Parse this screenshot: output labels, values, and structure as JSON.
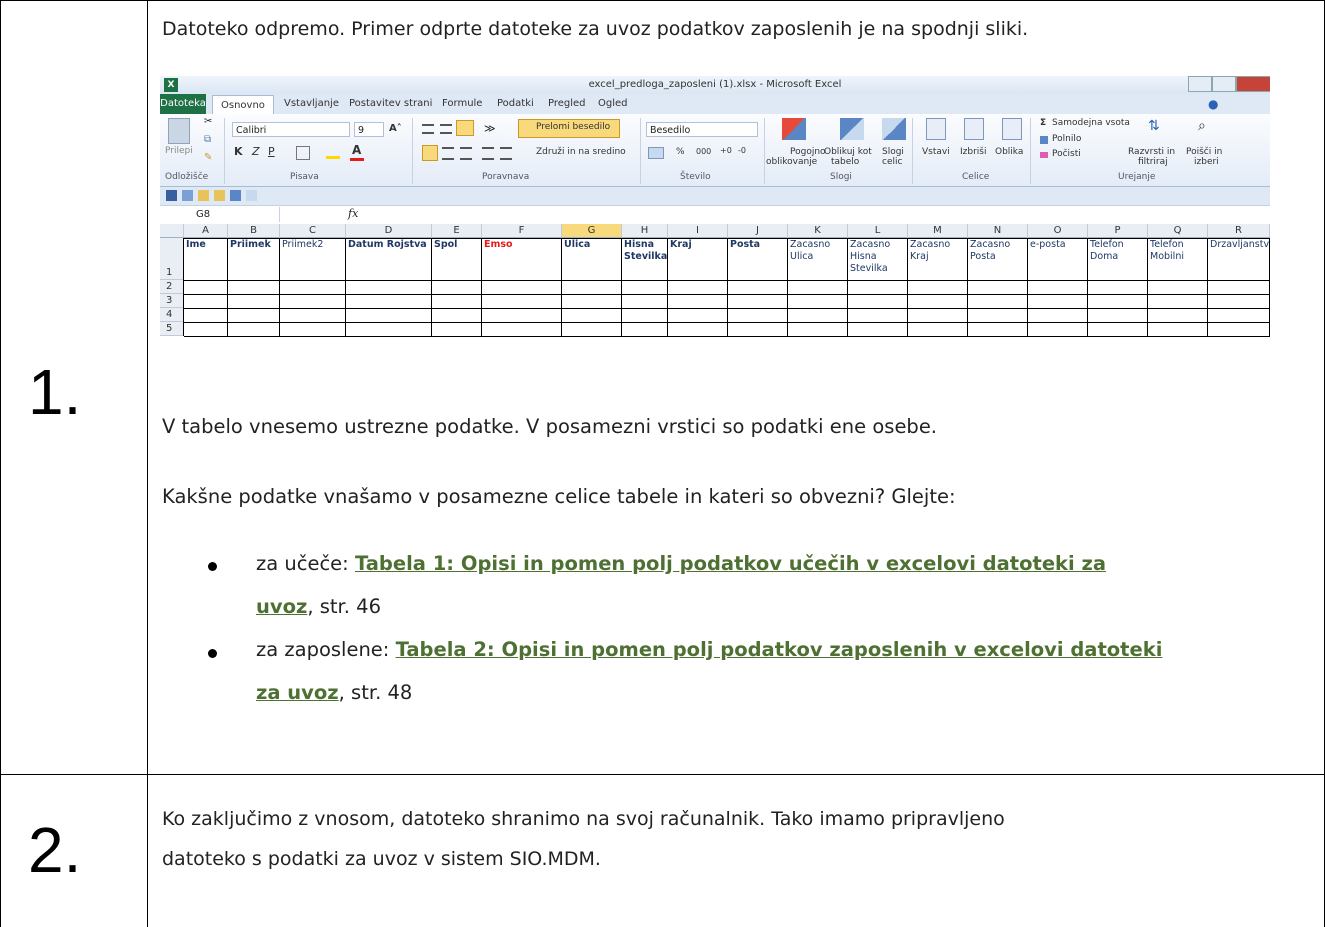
{
  "steps": [
    {
      "number": "1.",
      "intro": "Datoteko odpremo. Primer odprte datoteke za uvoz podatkov zaposlenih je na spodnji sliki.",
      "para_enter": "V tabelo vnesemo ustrezne podatke. V posamezni vrstici so podatki ene osebe.",
      "para_question": "Kakšne podatke vnašamo v posamezne celice tabele in kateri so obvezni? Glejte:",
      "bullets": [
        {
          "prefix": "za učeče: ",
          "link_line1": "Tabela 1: Opisi in pomen polj podatkov učečih v excelovi datoteki za",
          "link_line2": "uvoz",
          "suffix": ", str. 46"
        },
        {
          "prefix": "za zaposlene: ",
          "link_line1": "Tabela 2: Opisi in pomen polj podatkov zaposlenih v excelovi datoteki",
          "link_line2": "za uvoz",
          "suffix": ", str. 48"
        }
      ]
    },
    {
      "number": "2.",
      "line1": "Ko zaključimo z vnosom, datoteko shranimo na svoj računalnik. Tako imamo pripravljeno",
      "line2": "datoteko s podatki za uvoz v sistem SIO.MDM."
    }
  ],
  "excel": {
    "window_title": "excel_predloga_zaposleni (1).xlsx - Microsoft Excel",
    "tabs": [
      "Datoteka",
      "Osnovno",
      "Vstavljanje",
      "Postavitev strani",
      "Formule",
      "Podatki",
      "Pregled",
      "Ogled"
    ],
    "ribbon": {
      "paste": "Prilepi",
      "font_name": "Calibri",
      "font_size": "9",
      "wrap_text": "Prelomi besedilo",
      "merge_center": "Združi in na sredino",
      "number_format": "Besedilo",
      "percent": "%",
      "thousands": "000",
      "cond_format_1": "Pogojno",
      "cond_format_2": "oblikovanje",
      "format_table_1": "Oblikuj kot",
      "format_table_2": "tabelo",
      "cell_styles_1": "Slogi",
      "cell_styles_2": "celic",
      "insert": "Vstavi",
      "delete": "Izbriši",
      "format": "Oblika",
      "autosum": "Samodejna vsota",
      "fill": "Polnilo",
      "clear": "Počisti",
      "sort_1": "Razvrsti in",
      "sort_2": "filtriraj",
      "find_1": "Poišči in",
      "find_2": "izberi",
      "groups": [
        "Odložišče",
        "Pisava",
        "Poravnava",
        "Število",
        "Slogi",
        "Celice",
        "Urejanje"
      ]
    },
    "name_box": "G8",
    "fx_label": "fx",
    "columns": [
      "A",
      "B",
      "C",
      "D",
      "E",
      "F",
      "G",
      "H",
      "I",
      "J",
      "K",
      "L",
      "M",
      "N",
      "O",
      "P",
      "Q",
      "R"
    ],
    "headers": [
      "Ime",
      "Priimek",
      "Priimek2",
      "Datum Rojstva",
      "Spol",
      "Emso",
      "Ulica",
      "Hisna Stevilka",
      "Kraj",
      "Posta",
      "Zacasno Ulica",
      "Zacasno Hisna Stevilka",
      "Zacasno Kraj",
      "Zacasno Posta",
      "e-posta",
      "Telefon Doma",
      "Telefon Mobilni",
      "Drzavljanstvo"
    ],
    "rows": [
      "1",
      "2",
      "3",
      "4",
      "5"
    ],
    "colors": {
      "bold_header": "#1f3864",
      "emso": "#e31b1b",
      "file_tab": "#1e7145",
      "selected_col": "#f8d97b"
    }
  },
  "colors": {
    "link": "#4f7033"
  }
}
